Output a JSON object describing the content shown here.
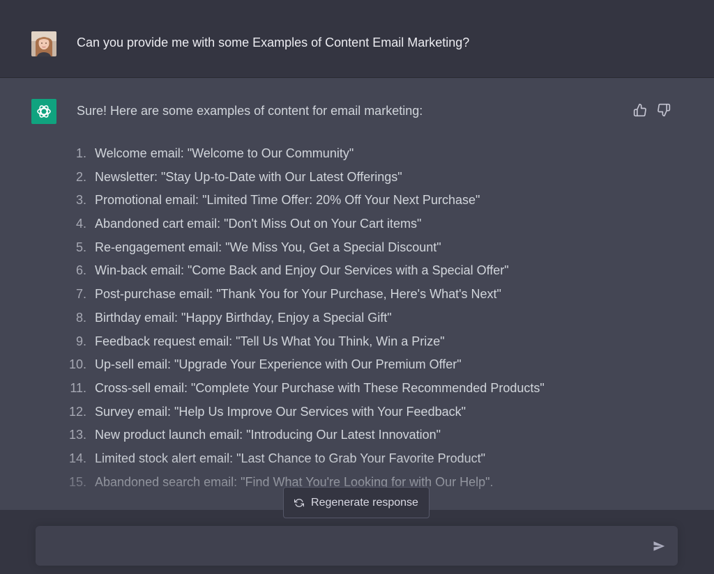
{
  "user_message": {
    "text": "Can you provide me with some Examples of Content Email Marketing?"
  },
  "assistant_message": {
    "intro": "Sure! Here are some examples of content for email marketing:",
    "items": [
      {
        "num": "1.",
        "text": "Welcome email: \"Welcome to Our Community\""
      },
      {
        "num": "2.",
        "text": "Newsletter: \"Stay Up-to-Date with Our Latest Offerings\""
      },
      {
        "num": "3.",
        "text": "Promotional email: \"Limited Time Offer: 20% Off Your Next Purchase\""
      },
      {
        "num": "4.",
        "text": "Abandoned cart email: \"Don't Miss Out on Your Cart items\""
      },
      {
        "num": "5.",
        "text": "Re-engagement email: \"We Miss You, Get a Special Discount\""
      },
      {
        "num": "6.",
        "text": "Win-back email: \"Come Back and Enjoy Our Services with a Special Offer\""
      },
      {
        "num": "7.",
        "text": "Post-purchase email: \"Thank You for Your Purchase, Here's What's Next\""
      },
      {
        "num": "8.",
        "text": "Birthday email: \"Happy Birthday, Enjoy a Special Gift\""
      },
      {
        "num": "9.",
        "text": "Feedback request email: \"Tell Us What You Think, Win a Prize\""
      },
      {
        "num": "10.",
        "text": "Up-sell email: \"Upgrade Your Experience with Our Premium Offer\""
      },
      {
        "num": "11.",
        "text": "Cross-sell email: \"Complete Your Purchase with These Recommended Products\""
      },
      {
        "num": "12.",
        "text": "Survey email: \"Help Us Improve Our Services with Your Feedback\""
      },
      {
        "num": "13.",
        "text": "New product launch email: \"Introducing Our Latest Innovation\""
      },
      {
        "num": "14.",
        "text": "Limited stock alert email: \"Last Chance to Grab Your Favorite Product\""
      },
      {
        "num": "15.",
        "text": "Abandoned search email: \"Find What You're Looking for with Our Help\"."
      }
    ]
  },
  "controls": {
    "regenerate_label": "Regenerate response",
    "input_placeholder": ""
  },
  "icons": {
    "thumbs_up": "thumbs-up-icon",
    "thumbs_down": "thumbs-down-icon",
    "regenerate": "refresh-icon",
    "send": "send-icon",
    "assistant_logo": "openai-logo-icon",
    "user_avatar": "user-avatar-photo"
  },
  "colors": {
    "background": "#343541",
    "assistant_background": "#444654",
    "accent": "#10a37f",
    "input_background": "#40414f"
  }
}
